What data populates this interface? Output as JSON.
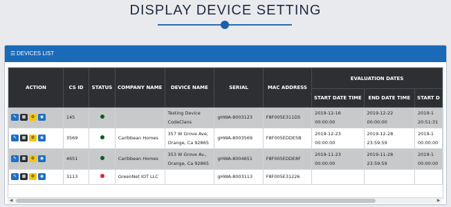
{
  "page_title": "DISPLAY DEVICE SETTING",
  "panel": {
    "title": "DEVICES LIST",
    "icon": "list-icon"
  },
  "columns": {
    "action": "ACTION",
    "cs_id": "CS ID",
    "status": "STATUS",
    "company_name": "COMPANY NAME",
    "device_name": "DEVICE NAME",
    "serial": "SERIAL",
    "mac_address": "MAC ADDRESS",
    "evaluation_dates": "EVALUATION DATES",
    "start_date_time": "START DATE TIME",
    "end_date_time": "END DATE TIME",
    "start_d_partial": "START D"
  },
  "action_icons": [
    "edit-icon",
    "calendar-icon",
    "gear-icon",
    "eye-icon"
  ],
  "status_colors": {
    "online": "#0b5d1e",
    "offline": "#e8202a"
  },
  "rows": [
    {
      "cs_id": "145",
      "status": "online",
      "company": "",
      "device_line1": "Testing Device",
      "device_line2": "CodeClans",
      "serial": "gHWA-8003123",
      "mac": "F8F005E311D5",
      "start_line1": "2019-12-16",
      "start_line2": "00:00:00",
      "end_line1": "2019-12-22",
      "end_line2": "00:00:00",
      "start2_line1": "2019-1",
      "start2_line2": "20:51:31"
    },
    {
      "cs_id": "3569",
      "status": "online",
      "company": "Caribbean Homes",
      "device_line1": "357 W Grove Ave,",
      "device_line2": "Orange, Ca 92865",
      "serial": "gHWA-8003569",
      "mac": "F8F005EDDE5B",
      "start_line1": "2019-12-23",
      "start_line2": "00:00:00",
      "end_line1": "2019-12-28",
      "end_line2": "23:59:59",
      "start2_line1": "2019-1",
      "start2_line2": "00:00:00"
    },
    {
      "cs_id": "4651",
      "status": "online",
      "company": "Caribbean Homes",
      "device_line1": "353 W Grove Av.,",
      "device_line2": "Orange, Ca 92865",
      "serial": "gHWA-8004651",
      "mac": "F8F005EDDE8F",
      "start_line1": "2019-11-23",
      "start_line2": "00:00:00",
      "end_line1": "2019-11-28",
      "end_line2": "23:59:59",
      "start2_line1": "2019-1",
      "start2_line2": "00:00:00"
    },
    {
      "cs_id": "3113",
      "status": "offline",
      "company": "GreenNet IOT LLC",
      "device_line1": "",
      "device_line2": "",
      "serial": "gHWA-8003113",
      "mac": "F8F005E31226",
      "start_line1": "",
      "start_line2": "",
      "end_line1": "",
      "end_line2": "",
      "start2_line1": "",
      "start2_line2": ""
    }
  ]
}
